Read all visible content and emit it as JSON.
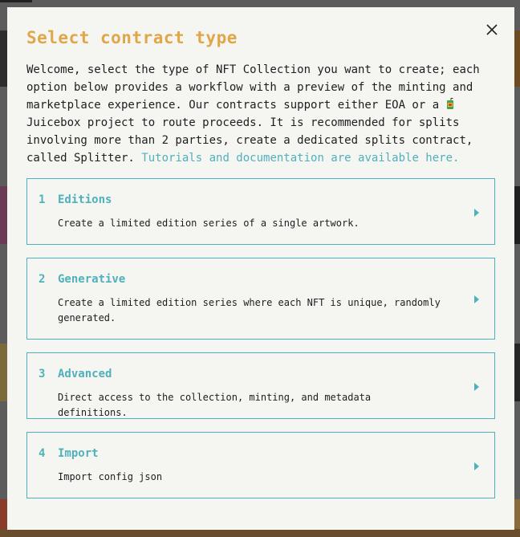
{
  "modal": {
    "title": "Select contract type",
    "intro_text": "Welcome, select the type of NFT Collection you want to create; each option below provides a workflow with a preview of the minting and marketplace experience. Our contracts support either EOA or a ",
    "intro_text_2": " Juicebox project to route proceeds. It is recommended for splits involving more than 2 parties, create a dedicated splits contract, called Splitter. ",
    "docs_link": "Tutorials and documentation are available here.",
    "close_icon": "close-icon",
    "juicebox_icon": "juicebox-icon"
  },
  "options": [
    {
      "num": "1",
      "title": "Editions",
      "desc": "Create a limited edition series of a single artwork."
    },
    {
      "num": "2",
      "title": "Generative",
      "desc": "Create a limited edition series where each NFT is unique, randomly generated."
    },
    {
      "num": "3",
      "title": "Advanced",
      "desc": "Direct access to the collection, minting, and metadata definitions."
    },
    {
      "num": "4",
      "title": "Import",
      "desc": "Import config json"
    }
  ],
  "colors": {
    "accent": "#4fb1bb",
    "title": "#e0a748",
    "modal_bg": "#f5f5f2",
    "overlay": "#5e5e5e"
  }
}
